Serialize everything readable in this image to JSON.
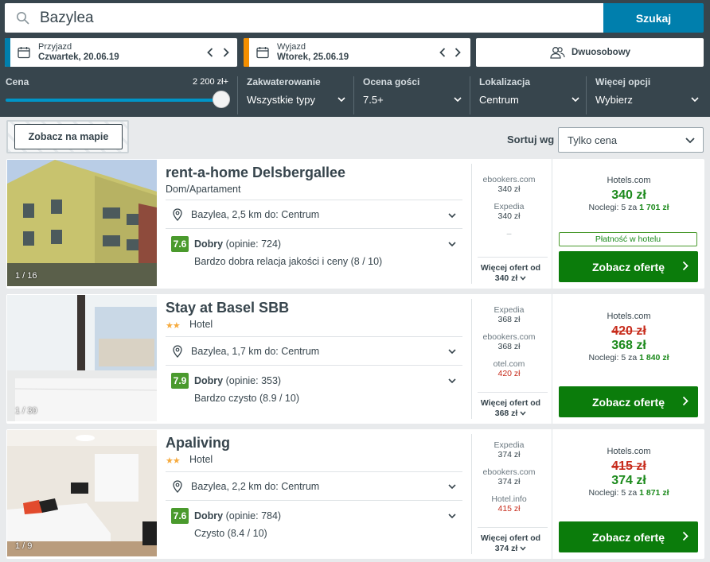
{
  "search": {
    "value": "Bazylea",
    "button": "Szukaj"
  },
  "checkin": {
    "label": "Przyjazd",
    "date": "Czwartek, 20.06.19",
    "color": "#007fad"
  },
  "checkout": {
    "label": "Wyjazd",
    "date": "Wtorek, 25.06.19",
    "color": "#f48f00"
  },
  "room": {
    "label": "Dwuosobowy"
  },
  "filters": {
    "price": {
      "label": "Cena",
      "value": "2 200 zł+",
      "slider_fraction": 1.0
    },
    "accommodation": {
      "label": "Zakwaterowanie",
      "value": "Wszystkie typy"
    },
    "rating": {
      "label": "Ocena gości",
      "value": "7.5+"
    },
    "location": {
      "label": "Lokalizacja",
      "value": "Centrum"
    },
    "more": {
      "label": "Więcej opcji",
      "value": "Wybierz"
    }
  },
  "map": {
    "button": "Zobacz na mapie"
  },
  "sort": {
    "label": "Sortuj wg",
    "value": "Tylko cena"
  },
  "hotels": [
    {
      "name": "rent-a-home Delsbergallee",
      "type": "Dom/Apartament",
      "stars": "",
      "photo_count": "1 / 16",
      "location": "Bazylea, 2,5 km do: Centrum",
      "rating": "7.6",
      "rating_word": "Dobry",
      "reviews": "(opinie: 724)",
      "detail": "Bardzo dobra relacja jakości i ceny (8 / 10)",
      "offers": [
        {
          "site": "ebookers.com",
          "price": "340 zł"
        },
        {
          "site": "Expedia",
          "price": "340 zł"
        },
        {
          "site": "–",
          "price": ""
        }
      ],
      "more_label": "Więcej ofert od",
      "more_price": "340 zł",
      "best_site": "Hotels.com",
      "best_old": "",
      "best_price": "340 zł",
      "nights_label": "Noclegi: 5 za",
      "nights_total": "1 701 zł",
      "pay_at_hotel": "Płatność w hotelu",
      "cta": "Zobacz ofertę"
    },
    {
      "name": "Stay at Basel SBB",
      "type": "Hotel",
      "stars": "★★",
      "photo_count": "1 / 30",
      "location": "Bazylea, 1,7 km do: Centrum",
      "rating": "7.9",
      "rating_word": "Dobry",
      "reviews": "(opinie: 353)",
      "detail": "Bardzo czysto (8.9 / 10)",
      "offers": [
        {
          "site": "Expedia",
          "price": "368 zł"
        },
        {
          "site": "ebookers.com",
          "price": "368 zł"
        },
        {
          "site": "otel.com",
          "price": "420 zł"
        }
      ],
      "more_label": "Więcej ofert od",
      "more_price": "368 zł",
      "best_site": "Hotels.com",
      "best_old": "420 zł",
      "best_price": "368 zł",
      "nights_label": "Noclegi: 5 za",
      "nights_total": "1 840 zł",
      "cta": "Zobacz ofertę"
    },
    {
      "name": "Apaliving",
      "type": "Hotel",
      "stars": "★★",
      "photo_count": "1 / 9",
      "location": "Bazylea, 2,2 km do: Centrum",
      "rating": "7.6",
      "rating_word": "Dobry",
      "reviews": "(opinie: 784)",
      "detail": "Czysto (8.4 / 10)",
      "offers": [
        {
          "site": "Expedia",
          "price": "374 zł"
        },
        {
          "site": "ebookers.com",
          "price": "374 zł"
        },
        {
          "site": "Hotel.info",
          "price": "415 zł"
        }
      ],
      "more_label": "Więcej ofert od",
      "more_price": "374 zł",
      "best_site": "Hotels.com",
      "best_old": "415 zł",
      "best_price": "374 zł",
      "nights_label": "Noclegi: 5 za",
      "nights_total": "1 871 zł",
      "cta": "Zobacz ofertę"
    }
  ],
  "colors": {
    "header": "#37454d",
    "search_button": "#007fad",
    "deal_button": "#0b7c0b",
    "price_green": "#1c8a1c",
    "price_red": "#c72c1c",
    "rating_badge": "#4a9a2d",
    "stars": "#f6ab3f"
  }
}
